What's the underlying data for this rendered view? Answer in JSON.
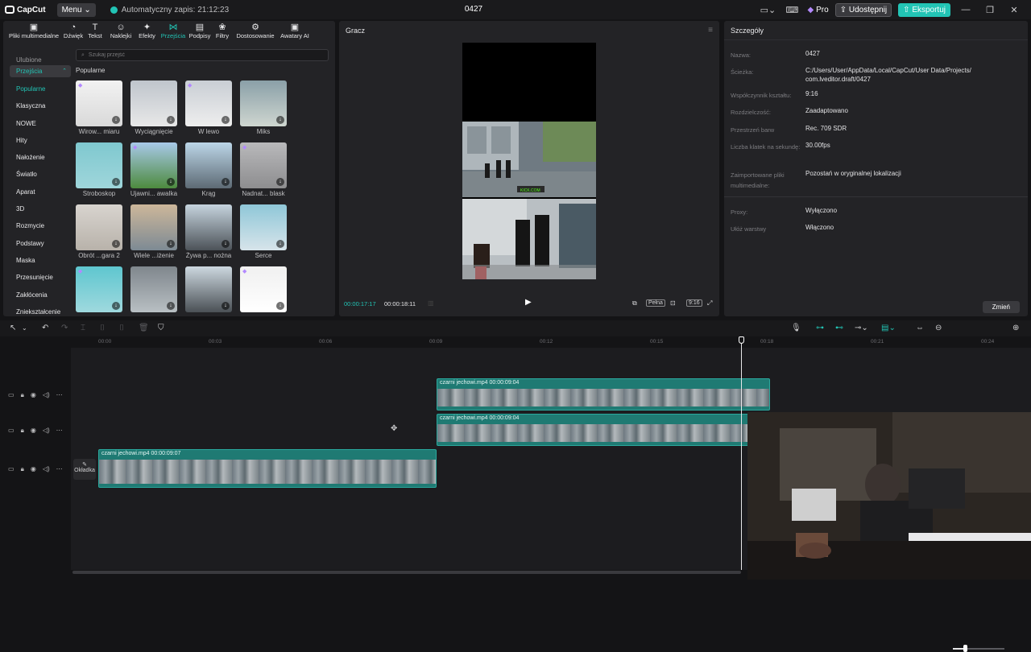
{
  "titlebar": {
    "app_name": "CapCut",
    "menu_label": "Menu",
    "autosave": "Automatyczny zapis: 21:12:23",
    "project_title": "0427",
    "pro_label": "Pro",
    "share_label": "Udostępnij",
    "export_label": "Eksportuj"
  },
  "toolbar": [
    {
      "label": "Pliki multimedialne",
      "icon": "media-icon"
    },
    {
      "label": "Dźwięk",
      "icon": "audio-icon"
    },
    {
      "label": "Tekst",
      "icon": "text-icon"
    },
    {
      "label": "Naklejki",
      "icon": "sticker-icon"
    },
    {
      "label": "Efekty",
      "icon": "effects-icon"
    },
    {
      "label": "Przejścia",
      "icon": "transitions-icon"
    },
    {
      "label": "Podpisy",
      "icon": "captions-icon"
    },
    {
      "label": "Filtry",
      "icon": "filters-icon"
    },
    {
      "label": "Dostosowanie",
      "icon": "adjust-icon"
    },
    {
      "label": "Awatary AI",
      "icon": "avatar-icon"
    }
  ],
  "sidebar": {
    "prev_item": "Ulubione",
    "header": "Przejścia",
    "items": [
      "Popularne",
      "Klasyczna",
      "NOWE",
      "Hity",
      "Nałożenie",
      "Światło",
      "Aparat",
      "3D",
      "Rozmycie",
      "Podstawy",
      "Maska",
      "Przesunięcie",
      "Zakłócenia",
      "Zniekształcenie"
    ]
  },
  "search": {
    "placeholder": "Szukaj przejść"
  },
  "section_title": "Popularne",
  "transitions": [
    {
      "label": "Wirow... miaru",
      "premium": true
    },
    {
      "label": "Wyciągnięcie",
      "premium": false
    },
    {
      "label": "W lewo",
      "premium": true
    },
    {
      "label": "Miks",
      "premium": false
    },
    {
      "label": "Stroboskop",
      "premium": false
    },
    {
      "label": "Ujawni... awaIka",
      "premium": true
    },
    {
      "label": "Krąg",
      "premium": false
    },
    {
      "label": "Nadnat... blask",
      "premium": true
    },
    {
      "label": "Obrót ...gara 2",
      "premium": false
    },
    {
      "label": "Wiele ...iżenie",
      "premium": false
    },
    {
      "label": "Żywa p... nożna",
      "premium": false
    },
    {
      "label": "Serce",
      "premium": false
    },
    {
      "label": "",
      "premium": true
    },
    {
      "label": "",
      "premium": false
    },
    {
      "label": "",
      "premium": false
    },
    {
      "label": "",
      "premium": true
    }
  ],
  "player": {
    "title": "Gracz",
    "current_time": "00:00:17:17",
    "total_time": "00:00:18:11",
    "full_label": "Pełna",
    "ratio_label": "9:16",
    "watermark": "KICK.COM"
  },
  "details": {
    "title": "Szczegóły",
    "rows": [
      {
        "key": "Nazwa:",
        "value": "0427"
      },
      {
        "key": "Ścieżka:",
        "value": "C:/Users/User/AppData/Local/CapCut/User Data/Projects/ com.lveditor.draft/0427"
      },
      {
        "key": "Współczynnik kształtu:",
        "value": "9:16"
      },
      {
        "key": "Rozdzielczość:",
        "value": "Zaadaptowano"
      },
      {
        "key": "Przestrzeń barw",
        "value": "Rec. 709 SDR"
      },
      {
        "key": "Liczba klatek na sekundę:",
        "value": "30.00fps"
      },
      {
        "key": "Zaimportowane pliki multimedialne:",
        "value": "Pozostań w oryginalnej lokalizacji"
      },
      {
        "key": "Proxy:",
        "value": "Wyłączono"
      },
      {
        "key": "Ułóż warstwy",
        "value": "Włączono"
      }
    ],
    "change_label": "Zmień"
  },
  "timeline": {
    "ticks": [
      "00:00",
      "00:03",
      "00:06",
      "00:09",
      "00:12",
      "00:15",
      "00:18",
      "00:21",
      "00:24"
    ],
    "cover_label": "Okładka",
    "clips": [
      {
        "label": "czarni jechowi.mp4   00:00:09:04"
      },
      {
        "label": "czarni jechowi.mp4   00:00:09:04"
      },
      {
        "label": "czarni jechowi.mp4   00:00:09:07"
      }
    ]
  },
  "colors": {
    "accent": "#22c4b5",
    "premium": "#b389ff",
    "clip": "#1f7a73"
  }
}
